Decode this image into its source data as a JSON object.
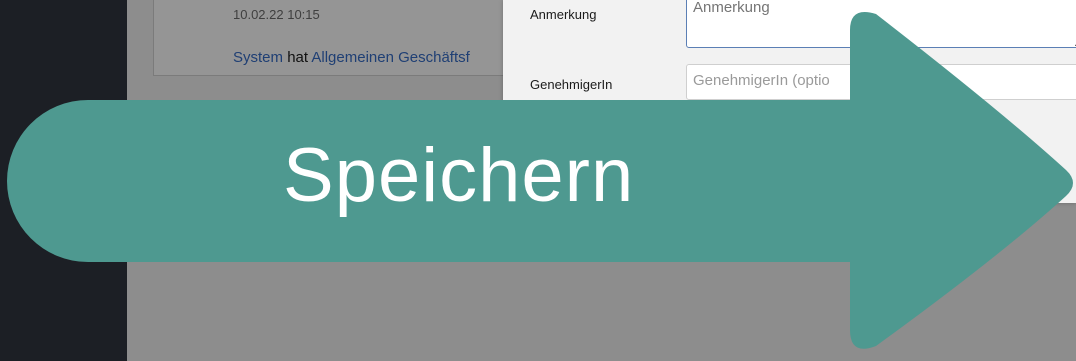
{
  "history": {
    "timestamp": "10.02.22 10:15",
    "actor": "System",
    "verb": "hat",
    "link_text": "Allgemeinen Geschäftsf"
  },
  "form": {
    "remark_label": "Anmerkung",
    "remark_placeholder": "Anmerkung",
    "approver_label": "GenehmigerIn",
    "approver_placeholder": "GenehmigerIn (optio"
  },
  "overlay": {
    "callout_text": "Speichern",
    "arrow_color": "#4e9990",
    "text_color": "#ffffff",
    "icon": "right-arrow-callout"
  }
}
